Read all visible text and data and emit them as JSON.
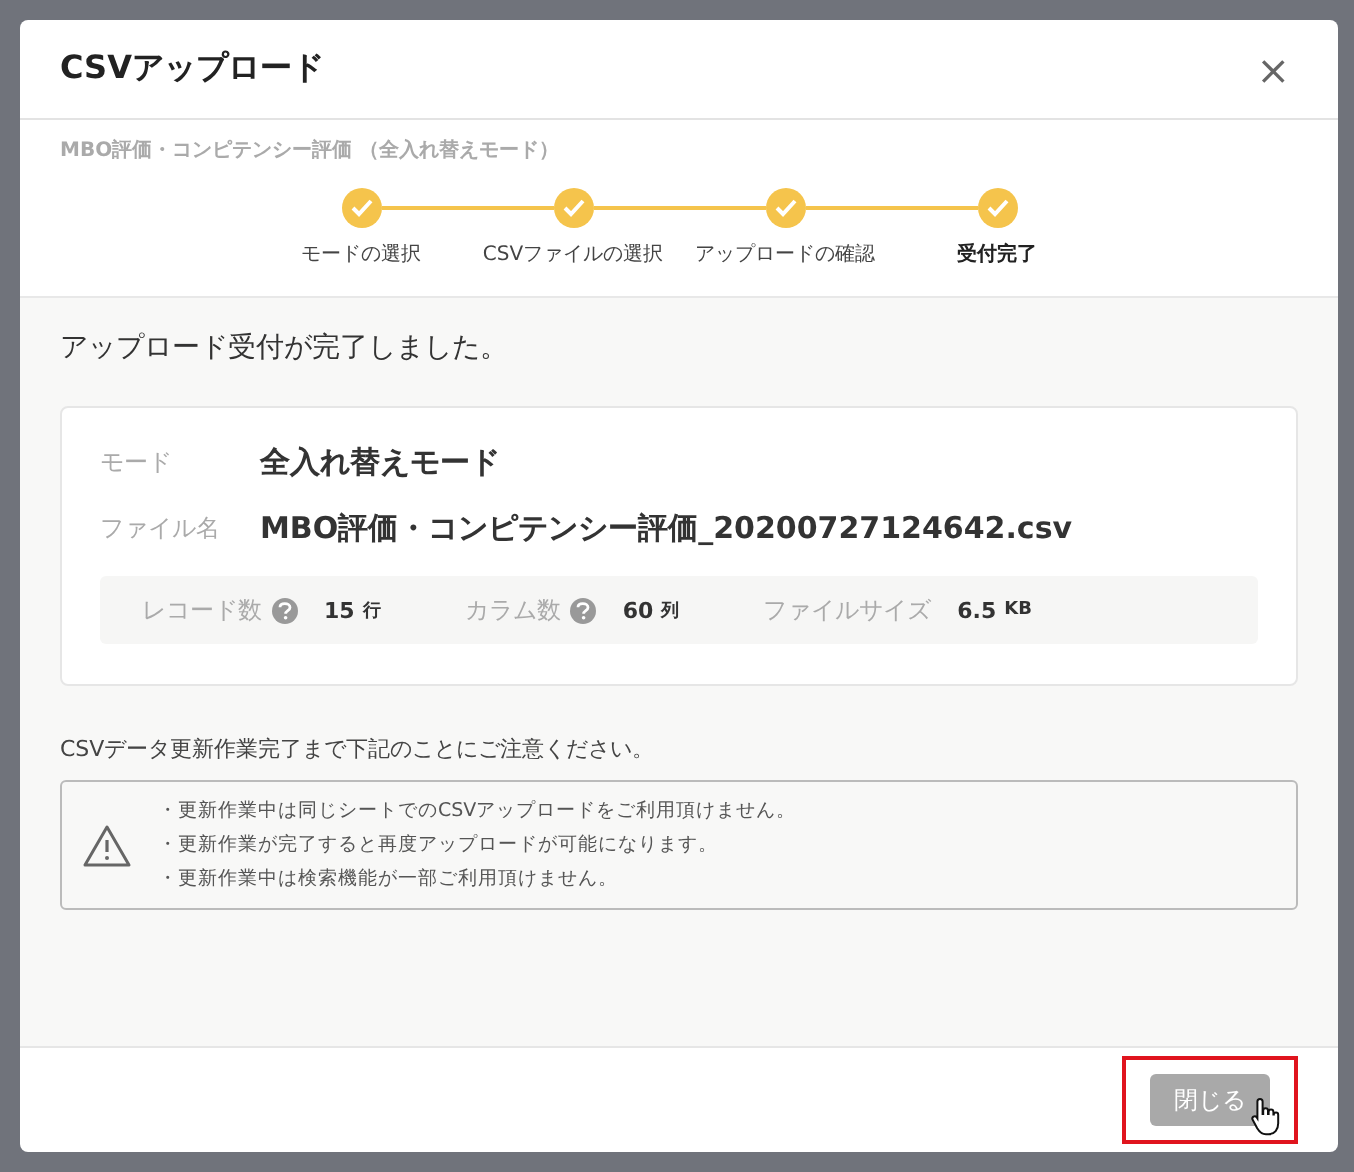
{
  "dialog": {
    "title": "CSVアップロード",
    "close": "×",
    "subtitle": "MBO評価・コンピテンシー評価 （全入れ替えモード）"
  },
  "steps": [
    {
      "label": "モードの選択",
      "done": true,
      "selected": false
    },
    {
      "label": "CSVファイルの選択",
      "done": true,
      "selected": false
    },
    {
      "label": "アップロードの確認",
      "done": true,
      "selected": false
    },
    {
      "label": "受付完了",
      "done": true,
      "selected": true
    }
  ],
  "message": "アップロード受付が完了しました。",
  "summary": [
    {
      "label": "モード",
      "value": "全入れ替えモード"
    },
    {
      "label": "ファイル名",
      "value": "MBO評価・コンピテンシー評価_20200727124642.csv"
    }
  ],
  "stats": [
    {
      "label": "レコード数",
      "help": true,
      "value": "15",
      "unit": "行"
    },
    {
      "label": "カラム数",
      "help": true,
      "value": "60",
      "unit": "列"
    },
    {
      "label": "ファイルサイズ",
      "help": false,
      "value": "6.5",
      "unit": "KB"
    }
  ],
  "note": "CSVデータ更新作業完了まで下記のことにご注意ください。",
  "warnings": [
    "・更新作業中は同じシートでのCSVアップロードをご利用頂けません。",
    "・更新作業が完了すると再度アップロードが可能になります。",
    "・更新作業中は検索機能が一部ご利用頂けません。"
  ],
  "footer": {
    "button": "閉じる",
    "disabled": true,
    "highlighted": true
  }
}
